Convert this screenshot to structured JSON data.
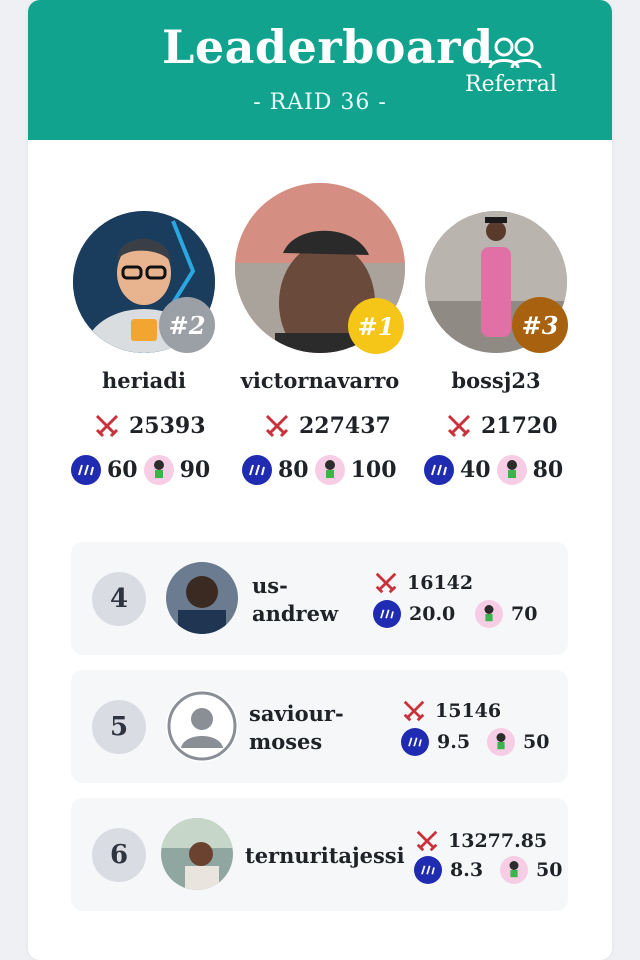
{
  "header": {
    "title": "Leaderboard",
    "subtitle": "- RAID 36 -",
    "referral_label": "Referral"
  },
  "colors": {
    "header_bg": "#12a38f",
    "gold": "#f5c518",
    "silver": "#9aa0a6",
    "bronze": "#a8620f",
    "steem_blue": "#1f2bb0",
    "sword_red": "#c9323a"
  },
  "podium": [
    {
      "rank_label": "#2",
      "name": "heriadi",
      "score": "25393",
      "steem": "60",
      "kids": "90"
    },
    {
      "rank_label": "#1",
      "name": "victornavarro",
      "score": "227437",
      "steem": "80",
      "kids": "100"
    },
    {
      "rank_label": "#3",
      "name": "bossj23",
      "score": "21720",
      "steem": "40",
      "kids": "80"
    }
  ],
  "rows": [
    {
      "rank": "4",
      "name_line1": "us-",
      "name_line2": "andrew",
      "score": "16142",
      "steem": "20.0",
      "kids": "70"
    },
    {
      "rank": "5",
      "name_line1": "saviour-",
      "name_line2": "moses",
      "score": "15146",
      "steem": "9.5",
      "kids": "50"
    },
    {
      "rank": "6",
      "name_line1": "ternuritajessi",
      "name_line2": "",
      "score": "13277.85",
      "steem": "8.3",
      "kids": "50"
    }
  ],
  "icons": {
    "referral": "users-icon",
    "score": "crossed-swords-icon",
    "steem": "steem-icon",
    "kids": "kid-character-icon"
  }
}
